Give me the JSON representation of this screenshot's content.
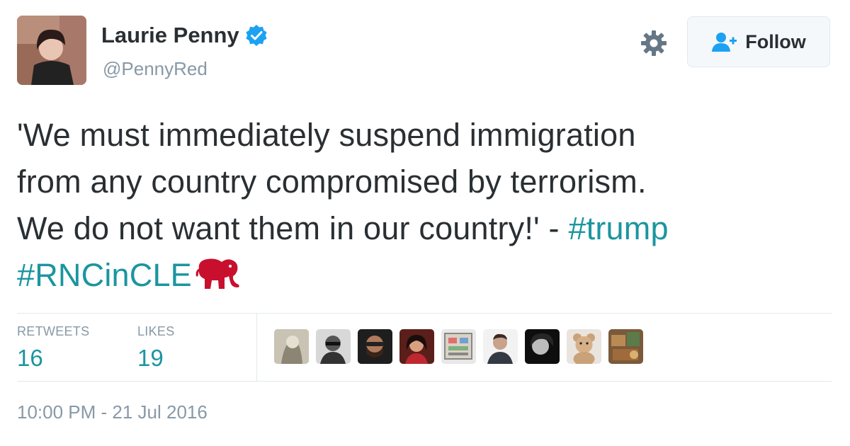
{
  "user": {
    "name": "Laurie Penny",
    "handle": "@PennyRed",
    "verified": true
  },
  "follow_button": {
    "label": "Follow"
  },
  "tweet": {
    "text_lines": [
      "'We must immediately suspend immigration",
      "from any country compromised by terrorism.",
      "We do not want them in our country!' - "
    ],
    "hashtag_trump": "#trump",
    "hashtag_rnc": "#RNCinCLE",
    "emoji": "elephant-emoji"
  },
  "stats": {
    "retweets_label": "RETWEETS",
    "retweets_value": "16",
    "likes_label": "LIKES",
    "likes_value": "19"
  },
  "likers": [
    {
      "icon": "liker-avatar"
    },
    {
      "icon": "liker-avatar"
    },
    {
      "icon": "liker-avatar"
    },
    {
      "icon": "liker-avatar"
    },
    {
      "icon": "liker-avatar"
    },
    {
      "icon": "liker-avatar"
    },
    {
      "icon": "liker-avatar"
    },
    {
      "icon": "liker-avatar"
    },
    {
      "icon": "liker-avatar"
    }
  ],
  "timestamp": "10:00 PM - 21 Jul 2016",
  "colors": {
    "hashtag": "#1b95a0",
    "verified": "#1da1f2",
    "muted": "#8899a6",
    "elephant": "#c8102e"
  }
}
